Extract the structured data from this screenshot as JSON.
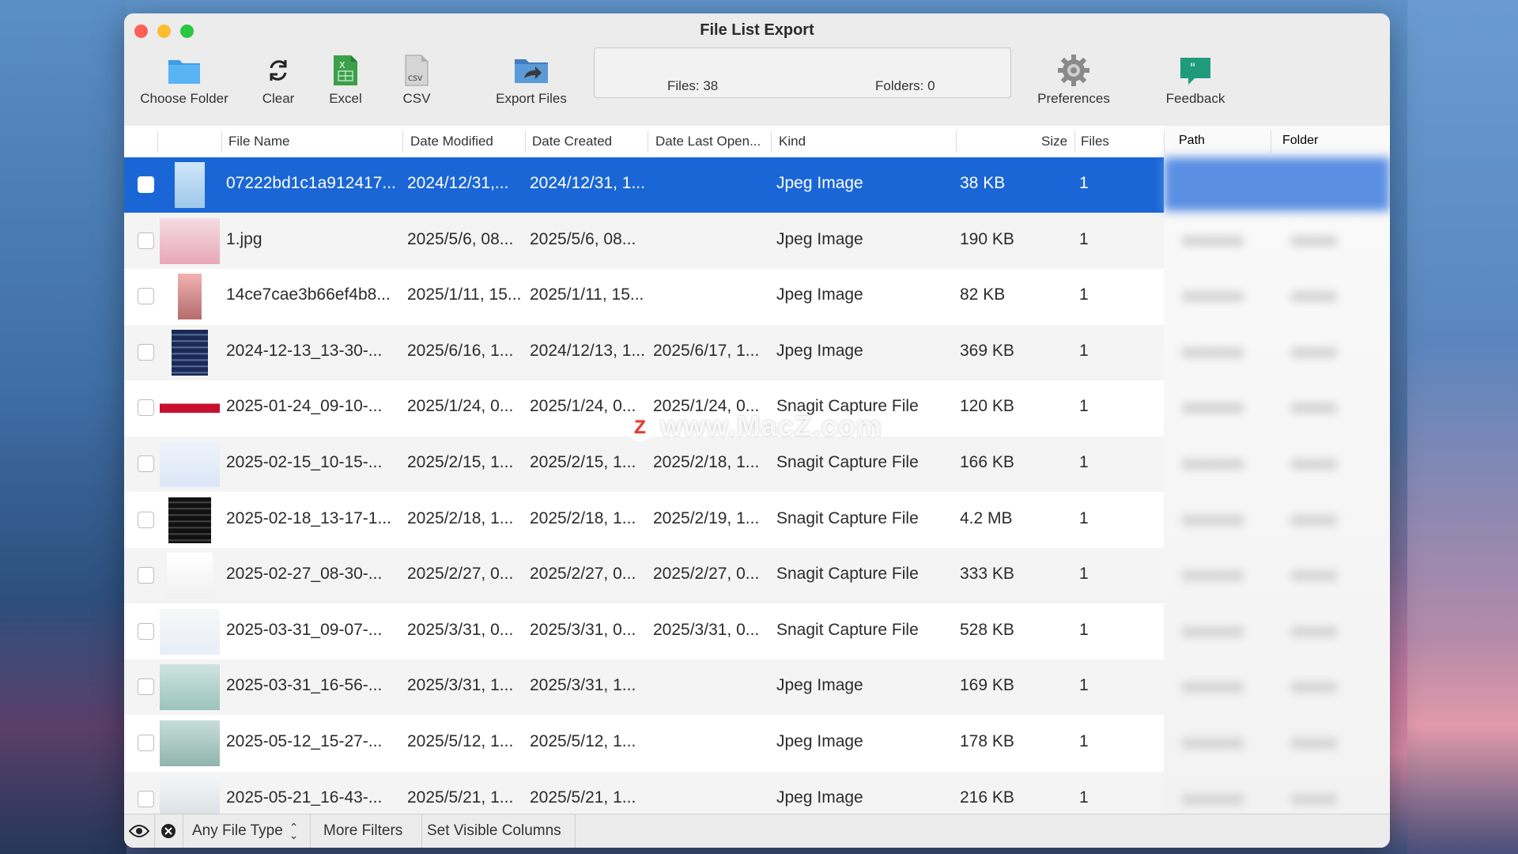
{
  "window": {
    "title": "File List Export"
  },
  "toolbar": {
    "choose_folder": "Choose Folder",
    "clear": "Clear",
    "excel": "Excel",
    "csv": "CSV",
    "export_files": "Export Files",
    "preferences": "Preferences",
    "feedback": "Feedback"
  },
  "stats": {
    "files": "Files: 38",
    "folders": "Folders: 0"
  },
  "columns": {
    "file_name": "File Name",
    "date_modified": "Date Modified",
    "date_created": "Date Created",
    "date_last_opened": "Date Last Open...",
    "kind": "Kind",
    "size": "Size",
    "files": "Files",
    "path": "Path",
    "folder": "Folder"
  },
  "rows": [
    {
      "name": "07222bd1c1a912417...",
      "modified": "2024/12/31,...",
      "created": "2024/12/31, 1...",
      "opened": "",
      "kind": "Jpeg Image",
      "size": "38 KB",
      "files": "1"
    },
    {
      "name": "1.jpg",
      "modified": "2025/5/6, 08...",
      "created": "2025/5/6, 08...",
      "opened": "",
      "kind": "Jpeg Image",
      "size": "190 KB",
      "files": "1"
    },
    {
      "name": "14ce7cae3b66ef4b8...",
      "modified": "2025/1/11, 15...",
      "created": "2025/1/11, 15...",
      "opened": "",
      "kind": "Jpeg Image",
      "size": "82 KB",
      "files": "1"
    },
    {
      "name": "2024-12-13_13-30-...",
      "modified": "2025/6/16, 1...",
      "created": "2024/12/13, 1...",
      "opened": "2025/6/17, 1...",
      "kind": "Jpeg Image",
      "size": "369 KB",
      "files": "1"
    },
    {
      "name": "2025-01-24_09-10-...",
      "modified": "2025/1/24, 0...",
      "created": "2025/1/24, 0...",
      "opened": "2025/1/24, 0...",
      "kind": "Snagit Capture File",
      "size": "120 KB",
      "files": "1"
    },
    {
      "name": "2025-02-15_10-15-...",
      "modified": "2025/2/15, 1...",
      "created": "2025/2/15, 1...",
      "opened": "2025/2/18, 1...",
      "kind": "Snagit Capture File",
      "size": "166 KB",
      "files": "1"
    },
    {
      "name": "2025-02-18_13-17-1...",
      "modified": "2025/2/18, 1...",
      "created": "2025/2/18, 1...",
      "opened": "2025/2/19, 1...",
      "kind": "Snagit Capture File",
      "size": "4.2 MB",
      "files": "1"
    },
    {
      "name": "2025-02-27_08-30-...",
      "modified": "2025/2/27, 0...",
      "created": "2025/2/27, 0...",
      "opened": "2025/2/27, 0...",
      "kind": "Snagit Capture File",
      "size": "333 KB",
      "files": "1"
    },
    {
      "name": "2025-03-31_09-07-...",
      "modified": "2025/3/31, 0...",
      "created": "2025/3/31, 0...",
      "opened": "2025/3/31, 0...",
      "kind": "Snagit Capture File",
      "size": "528 KB",
      "files": "1"
    },
    {
      "name": "2025-03-31_16-56-...",
      "modified": "2025/3/31, 1...",
      "created": "2025/3/31, 1...",
      "opened": "",
      "kind": "Jpeg Image",
      "size": "169 KB",
      "files": "1"
    },
    {
      "name": "2025-05-12_15-27-...",
      "modified": "2025/5/12, 1...",
      "created": "2025/5/12, 1...",
      "opened": "",
      "kind": "Jpeg Image",
      "size": "178 KB",
      "files": "1"
    },
    {
      "name": "2025-05-21_16-43-...",
      "modified": "2025/5/21, 1...",
      "created": "2025/5/21, 1...",
      "opened": "",
      "kind": "Jpeg Image",
      "size": "216 KB",
      "files": "1"
    }
  ],
  "footer": {
    "file_type": "Any File Type",
    "more_filters": "More Filters",
    "set_visible_columns": "Set Visible Columns"
  },
  "watermark": {
    "logo": "Z",
    "text": "www.MacZ.com"
  },
  "colors": {
    "selection": "#1a66d6",
    "close": "#fe5f57",
    "minimize": "#febc2e",
    "maximize": "#28c840"
  }
}
